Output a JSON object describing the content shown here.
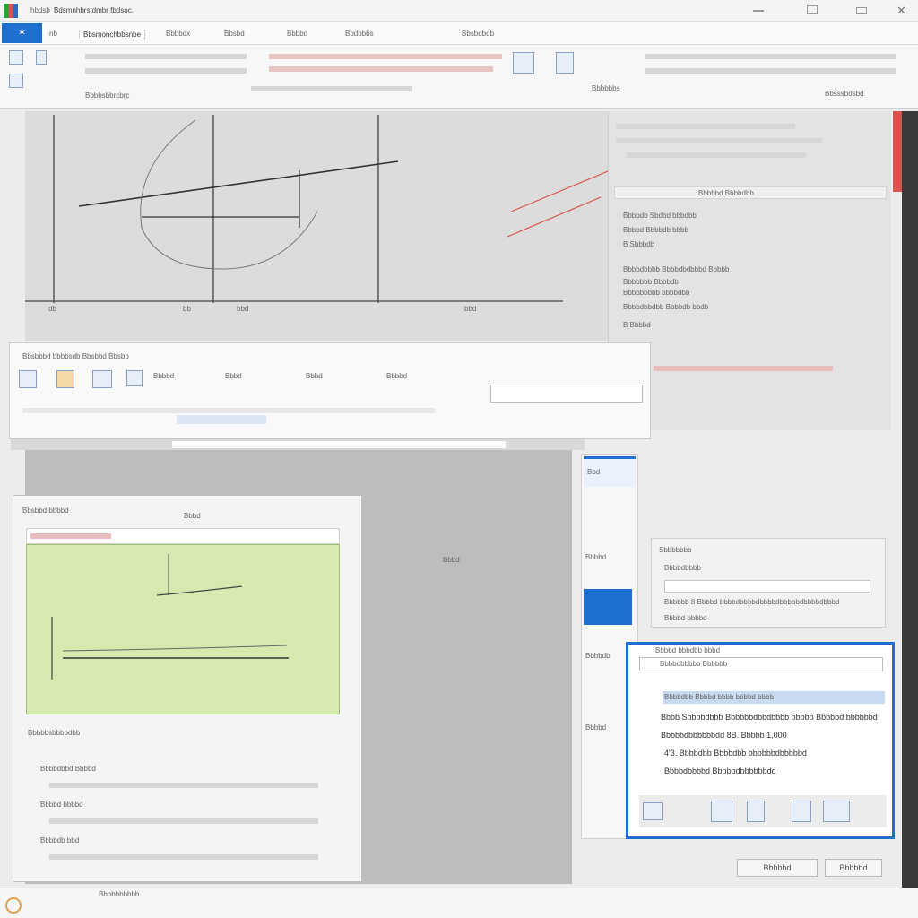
{
  "window": {
    "title": "Bdsmnhbrstdmbr fbdsoc.",
    "app_label": "hbdsb"
  },
  "ribbon": {
    "tab_file": "nb",
    "tab_active": "Bbsmonchbbsnbe",
    "tabs": [
      "Bbbbdx",
      "Bbsbd",
      "Bbbbd",
      "Bbdbbbs"
    ],
    "red_label": "Bbsbdbdb",
    "groups": [
      "Bbbbsbbrcbrc",
      "Bbbbbbs",
      "Bbsssbdsbd"
    ]
  },
  "diagram": {
    "axis_labels": [
      "db",
      "bb",
      "bbd",
      "bbd"
    ]
  },
  "right_panel": {
    "header": "Bbbbbd Bbbbdbb",
    "lines": [
      "Bbbbdb Sbdbd bbbdbb",
      "Bbbbd Bbbbdb bbbb",
      "B Sbbbdb",
      "Bbbbdbbbb Bbbbdbdbbbd Bbbbb",
      "Bbbbbbb Bbbbdb",
      "Bbbbbbbbb bbbbdbb",
      "Bbbbdbbdbb Bbbbdb bbdb",
      "B  Bbbbd"
    ]
  },
  "dialog": {
    "title": "Bbsbbbd bbbbsdb Bbsbbd Bbsbb",
    "buttons": [
      "Bbbbd",
      "Bbbd",
      "Bbbd",
      "Bbbbd"
    ],
    "search_placeholder": ""
  },
  "inner_window": {
    "title": "Bbsbbd bbbbd",
    "caption": "Bbbd",
    "annotation": "Bbbd",
    "footer_title": "Bbbbbsbbbbdbb",
    "footer_rows": [
      "Bbbbdbbd Bbbbd",
      "Bbbbd bbbbd",
      "Bbbbdb bbd"
    ]
  },
  "side_list": {
    "header": "Bbd",
    "items": [
      "Bbbbd",
      "Bbbbdb",
      "Bbbbd"
    ]
  },
  "property_panel": {
    "title": "Sbbbbbbb",
    "row1": "Bbbbdbbbb",
    "row2": "Bbbbbb 8 Bbbbd bbbbdbbbbdbbbbdbbbbbdbbbbdbbbd",
    "row3": "Bbbbd bbbbd"
  },
  "blue_dialog": {
    "header": "Bbbbd bbbdbb bbbd",
    "field": "Bbbbdbbbbb Bbbbbb",
    "selected": "Bbbbdbb Bbbbd bbbb bbbbd bbbb",
    "line1": "Bbbb Sbbbbdbbb Bbbbbbdbbdbbbb bbbbb Bbbbbd bbbbbbd",
    "line2": "Bbbbbdbbbbbbdd 8B. Bbbbb 1,000",
    "line3": "4'3.  Bbbbdbb Bbbbdbb bbbbbbdbbbbbd",
    "line4": "Bbbbdbbbbd Bbbbbdbbbbbbdd"
  },
  "footer_buttons": {
    "ok": "Bbbbbd",
    "cancel": "Bbbbbd"
  },
  "status": {
    "left": "Bbbbbbbbbb"
  },
  "colors": {
    "accent": "#1e6fd0",
    "annotation": "#d9534f",
    "green_canvas": "#d6eab0"
  }
}
